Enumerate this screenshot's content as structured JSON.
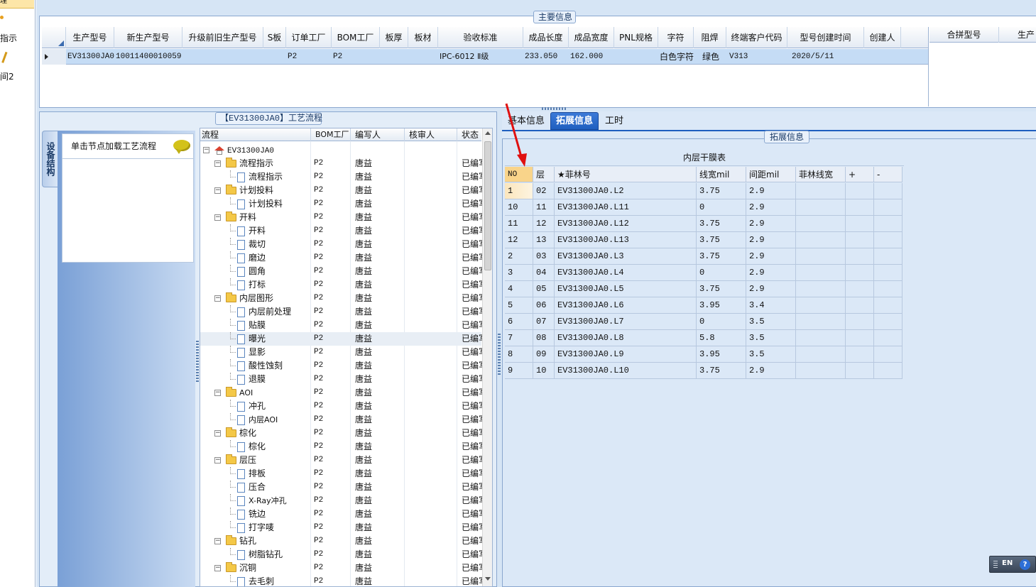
{
  "leftnav": {
    "items": [
      "理",
      "指示",
      "间2"
    ]
  },
  "main_info": {
    "legend": "主要信息",
    "columns": [
      "生产型号",
      "新生产型号",
      "升级前旧生产型号",
      "S板",
      "订单工厂",
      "BOM工厂",
      "板厚",
      "板材",
      "验收标准",
      "成品长度",
      "成品宽度",
      "PNL规格",
      "字符",
      "阻焊",
      "终端客户代码",
      "型号创建时间",
      "创建人"
    ],
    "row": {
      "prod_model": "EV31300JA0",
      "new_model": "10011400010059",
      "old_model": "",
      "s_board": "",
      "order_factory": "P2",
      "bom_factory": "P2",
      "thickness": "",
      "material": "",
      "standard": "IPC-6012 Ⅱ级",
      "length": "233.050",
      "width": "162.000",
      "pnl": "",
      "char": "白色字符",
      "solder": "绿色",
      "customer": "V313",
      "created": "2020/5/11",
      "creator": ""
    },
    "side_columns": [
      "合拼型号",
      "生产"
    ]
  },
  "process": {
    "legend": "【EV31300JA0】工艺流程",
    "side_tab": "设备结构",
    "hint": "单击节点加载工艺流程",
    "columns": [
      "流程",
      "BOM工厂",
      "编写人",
      "核审人",
      "状态"
    ],
    "root": "EV31300JA0",
    "rows": [
      {
        "name": "流程指示",
        "level": 1,
        "type": "folder",
        "factory": "P2",
        "author": "唐益",
        "status": "已编写"
      },
      {
        "name": "流程指示",
        "level": 2,
        "type": "doc",
        "factory": "P2",
        "author": "唐益",
        "status": "已编写"
      },
      {
        "name": "计划投料",
        "level": 1,
        "type": "folder",
        "factory": "P2",
        "author": "唐益",
        "status": "已编写"
      },
      {
        "name": "计划投料",
        "level": 2,
        "type": "doc",
        "factory": "P2",
        "author": "唐益",
        "status": "已编写"
      },
      {
        "name": "开料",
        "level": 1,
        "type": "folder",
        "factory": "P2",
        "author": "唐益",
        "status": "已编写"
      },
      {
        "name": "开料",
        "level": 2,
        "type": "doc",
        "factory": "P2",
        "author": "唐益",
        "status": "已编写"
      },
      {
        "name": "裁切",
        "level": 2,
        "type": "doc",
        "factory": "P2",
        "author": "唐益",
        "status": "已编写"
      },
      {
        "name": "磨边",
        "level": 2,
        "type": "doc",
        "factory": "P2",
        "author": "唐益",
        "status": "已编写"
      },
      {
        "name": "圆角",
        "level": 2,
        "type": "doc",
        "factory": "P2",
        "author": "唐益",
        "status": "已编写"
      },
      {
        "name": "打标",
        "level": 2,
        "type": "doc",
        "factory": "P2",
        "author": "唐益",
        "status": "已编写"
      },
      {
        "name": "内层图形",
        "level": 1,
        "type": "folder",
        "factory": "P2",
        "author": "唐益",
        "status": "已编写"
      },
      {
        "name": "内层前处理",
        "level": 2,
        "type": "doc",
        "factory": "P2",
        "author": "唐益",
        "status": "已编写"
      },
      {
        "name": "贴膜",
        "level": 2,
        "type": "doc",
        "factory": "P2",
        "author": "唐益",
        "status": "已编写"
      },
      {
        "name": "曝光",
        "level": 2,
        "type": "doc",
        "factory": "P2",
        "author": "唐益",
        "status": "已编写"
      },
      {
        "name": "显影",
        "level": 2,
        "type": "doc",
        "factory": "P2",
        "author": "唐益",
        "status": "已编写"
      },
      {
        "name": "酸性蚀刻",
        "level": 2,
        "type": "doc",
        "factory": "P2",
        "author": "唐益",
        "status": "已编写"
      },
      {
        "name": "退膜",
        "level": 2,
        "type": "doc",
        "factory": "P2",
        "author": "唐益",
        "status": "已编写"
      },
      {
        "name": "AOI",
        "level": 1,
        "type": "folder",
        "factory": "P2",
        "author": "唐益",
        "status": "已编写"
      },
      {
        "name": "冲孔",
        "level": 2,
        "type": "doc",
        "factory": "P2",
        "author": "唐益",
        "status": "已编写"
      },
      {
        "name": "内层AOI",
        "level": 2,
        "type": "doc",
        "factory": "P2",
        "author": "唐益",
        "status": "已编写"
      },
      {
        "name": "棕化",
        "level": 1,
        "type": "folder",
        "factory": "P2",
        "author": "唐益",
        "status": "已编写"
      },
      {
        "name": "棕化",
        "level": 2,
        "type": "doc",
        "factory": "P2",
        "author": "唐益",
        "status": "已编写"
      },
      {
        "name": "层压",
        "level": 1,
        "type": "folder",
        "factory": "P2",
        "author": "唐益",
        "status": "已编写"
      },
      {
        "name": "排板",
        "level": 2,
        "type": "doc",
        "factory": "P2",
        "author": "唐益",
        "status": "已编写"
      },
      {
        "name": "压合",
        "level": 2,
        "type": "doc",
        "factory": "P2",
        "author": "唐益",
        "status": "已编写"
      },
      {
        "name": "X-Ray冲孔",
        "level": 2,
        "type": "doc",
        "factory": "P2",
        "author": "唐益",
        "status": "已编写"
      },
      {
        "name": "铣边",
        "level": 2,
        "type": "doc",
        "factory": "P2",
        "author": "唐益",
        "status": "已编写"
      },
      {
        "name": "打字唛",
        "level": 2,
        "type": "doc",
        "factory": "P2",
        "author": "唐益",
        "status": "已编写"
      },
      {
        "name": "钻孔",
        "level": 1,
        "type": "folder",
        "factory": "P2",
        "author": "唐益",
        "status": "已编写"
      },
      {
        "name": "树脂钻孔",
        "level": 2,
        "type": "doc",
        "factory": "P2",
        "author": "唐益",
        "status": "已编写"
      },
      {
        "name": "沉铜",
        "level": 1,
        "type": "folder",
        "factory": "P2",
        "author": "唐益",
        "status": "已编写"
      },
      {
        "name": "去毛刺",
        "level": 2,
        "type": "doc",
        "factory": "P2",
        "author": "唐益",
        "status": "已编写"
      }
    ],
    "selected_index": 13
  },
  "tabs": {
    "items": [
      "基本信息",
      "拓展信息",
      "工时"
    ],
    "active": 1
  },
  "ext": {
    "legend": "拓展信息",
    "table_title": "内层干膜表",
    "columns": [
      "NO",
      "层",
      "★菲林号",
      "线宽mil",
      "间距mil",
      "菲林线宽",
      "+",
      "-"
    ],
    "rows": [
      [
        "1",
        "02",
        "EV31300JA0.L2",
        "3.75",
        "2.9"
      ],
      [
        "10",
        "11",
        "EV31300JA0.L11",
        "0",
        "2.9"
      ],
      [
        "11",
        "12",
        "EV31300JA0.L12",
        "3.75",
        "2.9"
      ],
      [
        "12",
        "13",
        "EV31300JA0.L13",
        "3.75",
        "2.9"
      ],
      [
        "2",
        "03",
        "EV31300JA0.L3",
        "3.75",
        "2.9"
      ],
      [
        "3",
        "04",
        "EV31300JA0.L4",
        "0",
        "2.9"
      ],
      [
        "4",
        "05",
        "EV31300JA0.L5",
        "3.75",
        "2.9"
      ],
      [
        "5",
        "06",
        "EV31300JA0.L6",
        "3.95",
        "3.4"
      ],
      [
        "6",
        "07",
        "EV31300JA0.L7",
        "0",
        "3.5"
      ],
      [
        "7",
        "08",
        "EV31300JA0.L8",
        "5.8",
        "3.5"
      ],
      [
        "8",
        "09",
        "EV31300JA0.L9",
        "3.95",
        "3.5"
      ],
      [
        "9",
        "10",
        "EV31300JA0.L10",
        "3.75",
        "2.9"
      ]
    ]
  },
  "ime": {
    "lang": "EN",
    "help": "?"
  },
  "colors": {
    "accent": "#1f5fbf",
    "selected_row": "#c5dcf5",
    "arrow": "#e01010",
    "panel": "#d6e5f5"
  }
}
